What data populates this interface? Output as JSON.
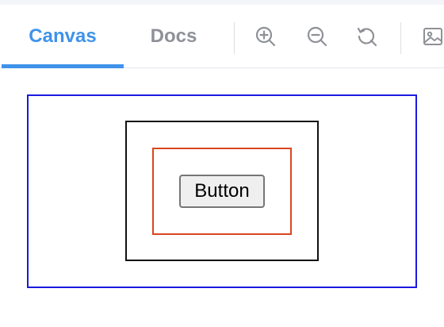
{
  "tabs": {
    "canvas": "Canvas",
    "docs": "Docs",
    "active": "canvas"
  },
  "toolbar": {
    "icons": [
      "zoom-in-icon",
      "zoom-out-icon",
      "reset-view-icon",
      "image-icon"
    ]
  },
  "canvas": {
    "button_label": "Button"
  },
  "colors": {
    "accent": "#3f93ea",
    "inactive_tab": "#8e9196",
    "outer_box": "#1a1ae0",
    "middle_box": "#111111",
    "inner_box": "#d9461f",
    "icon": "#8e9196"
  }
}
